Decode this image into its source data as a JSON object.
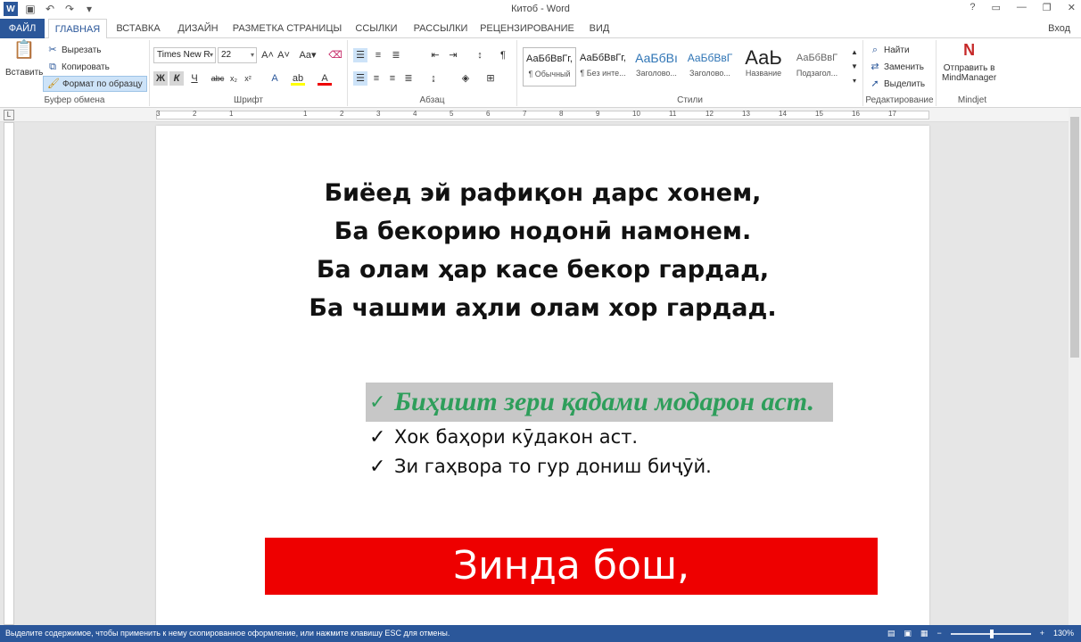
{
  "window": {
    "title": "Китоб - Word",
    "help": "?",
    "signin": "Вход"
  },
  "tabs": [
    "ФАЙЛ",
    "ГЛАВНАЯ",
    "ВСТАВКА",
    "ДИЗАЙН",
    "РАЗМЕТКА СТРАНИЦЫ",
    "ССЫЛКИ",
    "РАССЫЛКИ",
    "РЕЦЕНЗИРОВАНИЕ",
    "ВИД"
  ],
  "clipboard": {
    "paste": "Вставить",
    "cut": "Вырезать",
    "copy": "Копировать",
    "format_painter": "Формат по образцу",
    "label": "Буфер обмена"
  },
  "font": {
    "family": "Times New R",
    "size": "22",
    "label": "Шрифт"
  },
  "paragraph": {
    "label": "Абзац"
  },
  "styles": {
    "label": "Стили",
    "items": [
      {
        "preview": "АаБбВвГг,",
        "name": "¶ Обычный"
      },
      {
        "preview": "АаБбВвГг,",
        "name": "¶ Без инте..."
      },
      {
        "preview": "АаБбВı",
        "name": "Заголово..."
      },
      {
        "preview": "АаБбВвГ",
        "name": "Заголово..."
      },
      {
        "preview": "АаЬ",
        "name": "Название"
      },
      {
        "preview": "АаБбВвГ",
        "name": "Подзагол..."
      }
    ]
  },
  "editing": {
    "find": "Найти",
    "replace": "Заменить",
    "select": "Выделить",
    "label": "Редактирование"
  },
  "mindjet": {
    "send": "Отправить в",
    "app": "MindManager",
    "label": "Mindjet"
  },
  "ruler_numbers": [
    "3",
    "2",
    "1",
    "1",
    "2",
    "3",
    "4",
    "5",
    "6",
    "7",
    "8",
    "9",
    "10",
    "11",
    "12",
    "13",
    "14",
    "15",
    "16",
    "17"
  ],
  "document": {
    "poem": [
      "Биёед эй рафиқон дарс хонем,",
      "Ба бекорию нодонӣ намонем.",
      "Ба олам ҳар касе бекор гардад,",
      "Ба чашми аҳли олам хор гардад."
    ],
    "bullets": [
      "Биҳишт зери қадами модарон аст.",
      "Хок баҳори кӯдакон аст.",
      "Зи гаҳвора то гур дониш биҷӯй."
    ],
    "bullet_mark": "✓",
    "banner": "Зинда бош,"
  },
  "status": {
    "message": "Выделите содержимое, чтобы применить к нему скопированное оформление, или нажмите клавишу ESC для отмены.",
    "zoom": "130%"
  },
  "colors": {
    "accent": "#2b579a",
    "green_text": "#2e9e5b",
    "banner_red": "#ee0000"
  }
}
